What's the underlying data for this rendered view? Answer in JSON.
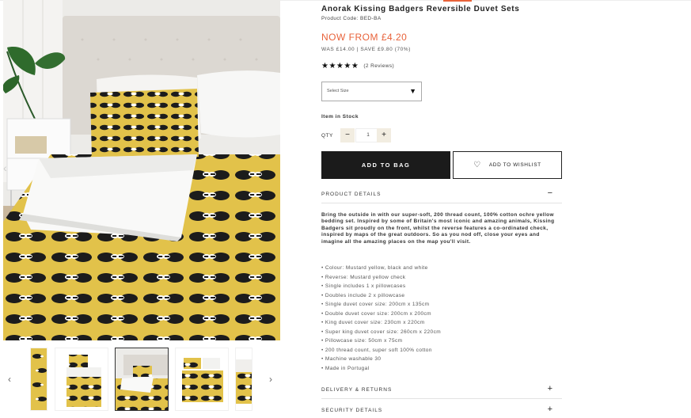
{
  "product": {
    "title": "Anorak Kissing Badgers Reversible Duvet Sets",
    "code": "Product Code: BED-BA",
    "price_now": "NOW FROM £4.20",
    "price_was": "WAS £14.00 | SAVE £9.80 (70%)",
    "stars": "★★★★★",
    "reviews": "(2 Reviews)",
    "size_placeholder": "Select Size",
    "stock": "Item in Stock",
    "qty_label": "QTY",
    "qty_value": "1",
    "qty_minus": "−",
    "qty_plus": "+",
    "add_to_bag": "ADD TO BAG",
    "add_to_wishlist": "ADD TO WISHLIST"
  },
  "accordion": {
    "details_label": "PRODUCT DETAILS",
    "details_symbol": "−",
    "delivery_label": "DELIVERY & RETURNS",
    "delivery_symbol": "+",
    "security_label": "SECURITY DETAILS",
    "security_symbol": "+"
  },
  "description": "Bring the outside in with our super-soft, 200 thread count, 100% cotton ochre yellow bedding set. Inspired by some of Britain's most iconic and amazing animals, Kissing Badgers sit proudly on the front, whilst the reverse features a co-ordinated check, inspired by maps of the great outdoors. So as you nod off, close your eyes and imagine all the amazing places on the map you'll visit.",
  "features": [
    "Colour: Mustard yellow, black and white",
    "Reverse: Mustard yellow check",
    "Single includes 1 x pillowcases",
    "Doubles include 2 x pillowcase",
    "Single duvet cover size: 200cm x 135cm",
    "Double duvet cover size: 200cm x 200cm",
    "King duvet cover size: 230cm x 220cm",
    "Super king duvet cover size: 260cm x 220cm",
    "Pillowcase size: 50cm x 75cm",
    "200 thread count, super soft 100% cotton",
    "Machine washable 30",
    "Made in Portugal"
  ],
  "gallery": {
    "prev_arrow": "‹",
    "next_arrow": "›",
    "main_prev": "‹"
  },
  "colors": {
    "accent": "#e8623a",
    "mustard": "#e2c24a",
    "button_dark": "#1b1b1b"
  }
}
